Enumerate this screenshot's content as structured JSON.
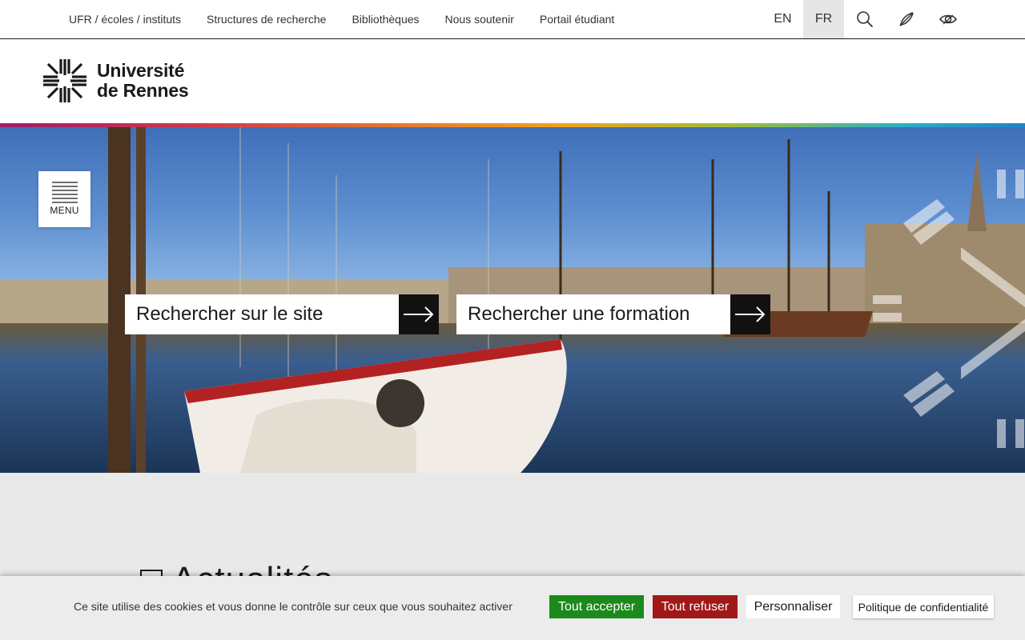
{
  "topnav": {
    "links": [
      "UFR / écoles / instituts",
      "Structures de recherche",
      "Bibliothèques",
      "Nous soutenir",
      "Portail étudiant"
    ],
    "lang_en": "EN",
    "lang_fr": "FR",
    "icons": [
      "search-icon",
      "rocket-icon",
      "eye-icon"
    ]
  },
  "header": {
    "logo_line1": "Université",
    "logo_line2": "de Rennes"
  },
  "hero": {
    "menu_label": "MENU",
    "search_site_placeholder": "Rechercher sur le site",
    "search_formation_placeholder": "Rechercher une formation"
  },
  "news": {
    "title": "Actualités"
  },
  "cookie": {
    "text": "Ce site utilise des cookies et vous donne le contrôle sur ceux que vous souhaitez activer",
    "accept": "Tout accepter",
    "refuse": "Tout refuser",
    "customize": "Personnaliser",
    "policy": "Politique de confidentialité"
  },
  "colors": {
    "accept": "#1b8a1b",
    "refuse": "#a11818",
    "active_lang_bg": "#e6e6e6"
  }
}
